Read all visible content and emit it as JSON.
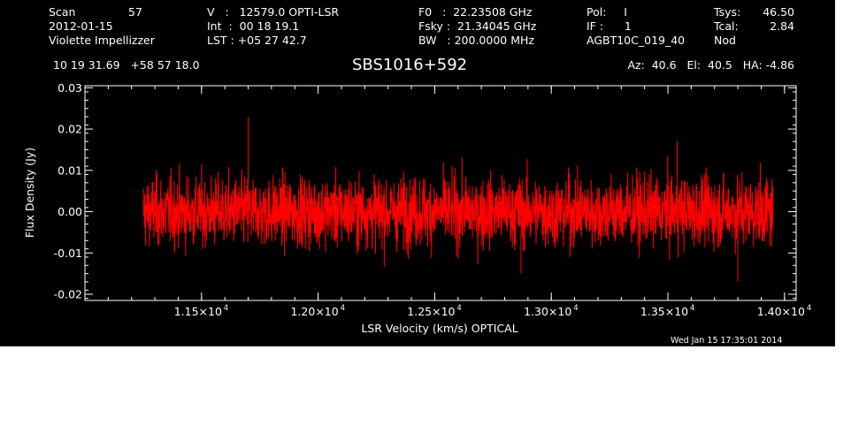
{
  "header": {
    "col1": [
      "Scan",
      "57",
      "2012-01-15",
      "Violette Impellizzer"
    ],
    "col2": [
      "V   :   12579.0 OPTI-LSR",
      "Int  :  00 18 19.1",
      "LST : +05 27 42.7"
    ],
    "col3": [
      "F0   :  22.23508 GHz",
      "Fsky :  21.34045 GHz",
      "BW   : 200.0000 MHz"
    ],
    "col4": [
      "Pol:     I",
      "IF :      1",
      "AGBT10C_019_40"
    ],
    "col5_labels": [
      "Tsys:",
      "Tcal:",
      "Nod"
    ],
    "col5_values": [
      "46.50",
      "2.84"
    ],
    "coords": "10 19 31.69   +58 57 18.0",
    "azel": "Az:  40.6   El:  40.5   HA: -4.86"
  },
  "chart_data": {
    "type": "line",
    "title": "SBS1016+592",
    "xlabel": "LSR Velocity (km/s) OPTICAL",
    "ylabel": "Flux Density (Jy)",
    "xlim": [
      11000,
      14050
    ],
    "ylim": [
      -0.0215,
      0.0305
    ],
    "x_range_data": [
      11250,
      13950
    ],
    "x_ticks": [
      {
        "value": 11500,
        "mantissa": "1.15",
        "exp": "4"
      },
      {
        "value": 12000,
        "mantissa": "1.20",
        "exp": "4"
      },
      {
        "value": 12500,
        "mantissa": "1.25",
        "exp": "4"
      },
      {
        "value": 13000,
        "mantissa": "1.30",
        "exp": "4"
      },
      {
        "value": 13500,
        "mantissa": "1.35",
        "exp": "4"
      },
      {
        "value": 14000,
        "mantissa": "1.40",
        "exp": "4"
      }
    ],
    "y_ticks": [
      {
        "value": 0.03,
        "label": "0.03"
      },
      {
        "value": 0.02,
        "label": "0.02"
      },
      {
        "value": 0.01,
        "label": "0.01"
      },
      {
        "value": 0.0,
        "label": "0.00"
      },
      {
        "value": -0.01,
        "label": "-0.01"
      },
      {
        "value": -0.02,
        "label": "-0.02"
      }
    ],
    "grid": false,
    "series": [
      {
        "name": "",
        "color": "#ff0000",
        "noise_rms": 0.0042,
        "peak_max": 0.023,
        "peak_min": -0.017
      }
    ]
  },
  "footer": {
    "timestamp": "Wed Jan 15 17:35:01 2014"
  },
  "colors": {
    "background": "#000000",
    "foreground": "#ffffff",
    "trace": "#ff0000"
  }
}
